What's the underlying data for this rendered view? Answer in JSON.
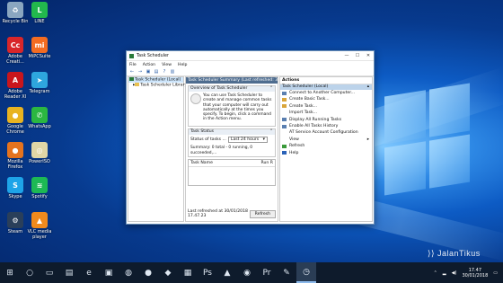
{
  "desktop": {
    "icons": [
      {
        "label": "Recycle Bin",
        "icon": "recycle-bin-icon",
        "color": "#8aa6c0",
        "glyph": "♻"
      },
      {
        "label": "LINE",
        "icon": "line-icon",
        "color": "#22b84d",
        "glyph": "L"
      },
      {
        "label": "Adobe\nCreati...",
        "icon": "adobe-cc-icon",
        "color": "#d8262a",
        "glyph": "Cc"
      },
      {
        "label": "MiPCSuite",
        "icon": "mi-icon",
        "color": "#f36c22",
        "glyph": "mi"
      },
      {
        "label": "Adobe\nReader XI",
        "icon": "adobe-reader-icon",
        "color": "#c8161d",
        "glyph": "A"
      },
      {
        "label": "Telegram",
        "icon": "telegram-icon",
        "color": "#2ea6de",
        "glyph": "➤"
      },
      {
        "label": "Google\nChrome",
        "icon": "chrome-icon",
        "color": "#e8b321",
        "glyph": "●"
      },
      {
        "label": "WhatsApp",
        "icon": "whatsapp-icon",
        "color": "#2bb741",
        "glyph": "✆"
      },
      {
        "label": "Mozilla\nFirefox",
        "icon": "firefox-icon",
        "color": "#e5731e",
        "glyph": "●"
      },
      {
        "label": "PowerISO",
        "icon": "poweriso-icon",
        "color": "#dfd6a6",
        "glyph": "◎"
      },
      {
        "label": "Skype",
        "icon": "skype-icon",
        "color": "#1ea4e8",
        "glyph": "S"
      },
      {
        "label": "Spotify",
        "icon": "spotify-icon",
        "color": "#1db954",
        "glyph": "≋"
      },
      {
        "label": "Steam",
        "icon": "steam-icon",
        "color": "#2a3f5a",
        "glyph": "⚙"
      },
      {
        "label": "VLC media\nplayer",
        "icon": "vlc-icon",
        "color": "#f08a1d",
        "glyph": "▲"
      }
    ]
  },
  "window": {
    "title": "Task Scheduler",
    "menu": [
      "File",
      "Action",
      "View",
      "Help"
    ],
    "tree": {
      "root": "Task Scheduler (Local)",
      "child": "Task Scheduler Library"
    },
    "center": {
      "header": "Task Scheduler Summary (Last refreshed: 30/01/2018 17...",
      "overview_title": "Overview of Task Scheduler",
      "overview_text": "You can use Task Scheduler to create and manage common tasks that your computer will carry out automatically at the times you specify. To begin, click a command in the Action menu.",
      "status_title": "Task Status",
      "status_label": "Status of tasks ...",
      "status_select": "Last 24 hours",
      "summary_text": "Summary: 0 total - 0 running, 0 succeeded,...",
      "col_task": "Task Name",
      "col_run": "Run R",
      "last_refreshed": "Last refreshed at 30/01/2018 17.47.23",
      "refresh_button": "Refresh"
    },
    "actions": {
      "title": "Actions",
      "subheader": "Task Scheduler (Local)",
      "items": [
        {
          "label": "Connect to Another Computer...",
          "icon": "computer-icon",
          "color": "#5a7fb0",
          "arrow": ""
        },
        {
          "label": "Create Basic Task...",
          "icon": "basic-task-icon",
          "color": "#d9a53a",
          "arrow": ""
        },
        {
          "label": "Create Task...",
          "icon": "create-task-icon",
          "color": "#d9a53a",
          "arrow": ""
        },
        {
          "label": "Import Task...",
          "icon": "import-icon",
          "color": "#ffffff",
          "arrow": ""
        },
        {
          "label": "Display All Running Tasks",
          "icon": "running-tasks-icon",
          "color": "#5a7fb0",
          "arrow": ""
        },
        {
          "label": "Enable All Tasks History",
          "icon": "history-icon",
          "color": "#5a7fb0",
          "arrow": ""
        },
        {
          "label": "AT Service Account Configuration",
          "icon": "blank-icon",
          "color": "#ffffff",
          "arrow": ""
        },
        {
          "label": "View",
          "icon": "blank-icon",
          "color": "#ffffff",
          "arrow": "▸"
        },
        {
          "label": "Refresh",
          "icon": "refresh-icon",
          "color": "#3a9a3a",
          "arrow": ""
        },
        {
          "label": "Help",
          "icon": "help-icon",
          "color": "#2a62b8",
          "arrow": ""
        }
      ]
    }
  },
  "taskbar": {
    "apps": [
      {
        "icon": "start-icon",
        "glyph": "⊞"
      },
      {
        "icon": "search-icon",
        "glyph": "○"
      },
      {
        "icon": "task-view-icon",
        "glyph": "▭"
      },
      {
        "icon": "explorer-icon",
        "glyph": "▤"
      },
      {
        "icon": "edge-icon",
        "glyph": "e"
      },
      {
        "icon": "store-icon",
        "glyph": "▣"
      },
      {
        "icon": "xbox-icon",
        "glyph": "◍"
      },
      {
        "icon": "chrome-taskbar-icon",
        "glyph": "●"
      },
      {
        "icon": "app-icon-1",
        "glyph": "◆"
      },
      {
        "icon": "app-icon-2",
        "glyph": "▦"
      },
      {
        "icon": "photoshop-icon",
        "glyph": "Ps"
      },
      {
        "icon": "app-icon-3",
        "glyph": "▲"
      },
      {
        "icon": "app-icon-4",
        "glyph": "◉"
      },
      {
        "icon": "premiere-icon",
        "glyph": "Pr"
      },
      {
        "icon": "app-icon-5",
        "glyph": "✎"
      },
      {
        "icon": "task-scheduler-taskbar-icon",
        "glyph": "◷"
      }
    ],
    "time": "17.47",
    "date": "30/01/2018"
  },
  "watermark": "JalanTikus"
}
